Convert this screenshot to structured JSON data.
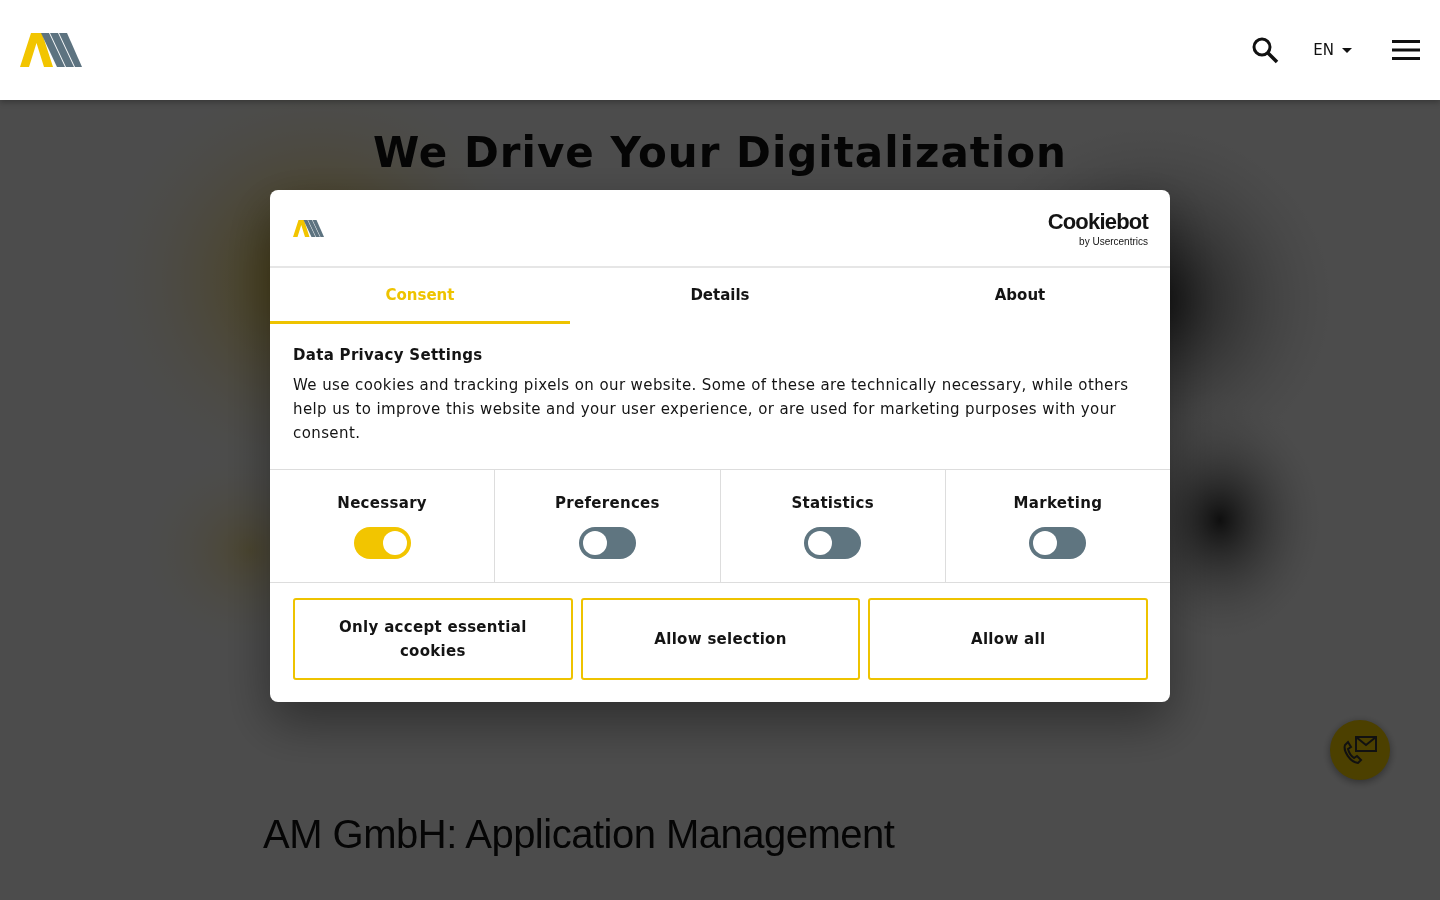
{
  "header": {
    "language": "EN"
  },
  "hero": {
    "title": "We Drive Your Digitalization"
  },
  "section": {
    "heading": "AM GmbH: Application Management"
  },
  "consent_dialog": {
    "provider": {
      "name": "Cookiebot",
      "byline": "by Usercentrics"
    },
    "tabs": [
      {
        "label": "Consent",
        "selected": true
      },
      {
        "label": "Details",
        "selected": false
      },
      {
        "label": "About",
        "selected": false
      }
    ],
    "title": "Data Privacy Settings",
    "text": "We use cookies and tracking pixels on our website. Some of these are technically necessary, while others help us to improve this website and your user experience, or are used for marketing purposes with your consent.",
    "categories": [
      {
        "label": "Necessary",
        "on": true
      },
      {
        "label": "Preferences",
        "on": false
      },
      {
        "label": "Statistics",
        "on": false
      },
      {
        "label": "Marketing",
        "on": false
      }
    ],
    "buttons": [
      "Only accept essential cookies",
      "Allow selection",
      "Allow all"
    ]
  }
}
